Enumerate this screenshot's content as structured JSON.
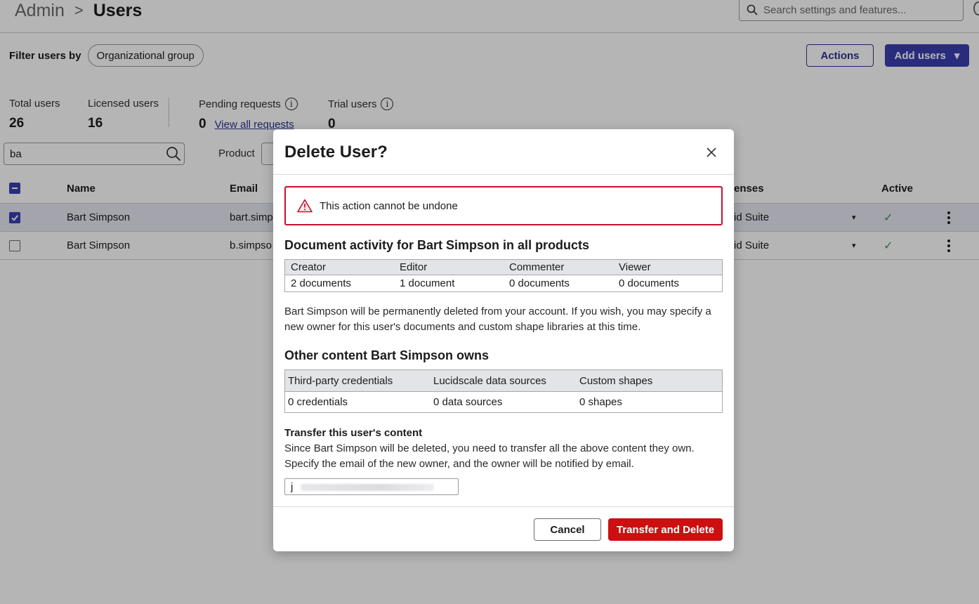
{
  "breadcrumb": {
    "parent": "Admin",
    "separator": ">",
    "current": "Users"
  },
  "search": {
    "placeholder": "Search settings and features...",
    "icon": "search-icon"
  },
  "filter": {
    "label": "Filter users by",
    "chip": "Organizational group"
  },
  "toolbar": {
    "actions_label": "Actions",
    "add_label": "Add users",
    "add_caret": "▾"
  },
  "stats": {
    "total_label": "Total users",
    "total_value": "26",
    "licensed_label": "Licensed users",
    "licensed_value": "16",
    "pending_label": "Pending requests",
    "pending_value": "0",
    "pending_link": "View all requests",
    "trial_label": "Trial users",
    "trial_value": "0",
    "info_glyph": "i"
  },
  "user_search": {
    "value": "ba"
  },
  "product_filter": {
    "label": "Product"
  },
  "table": {
    "headers": {
      "name": "Name",
      "email": "Email",
      "licenses": "enses",
      "active": "Active"
    },
    "rows": [
      {
        "selected": true,
        "name": "Bart Simpson",
        "email": "bart.simp",
        "license": "id Suite",
        "caret": "▾",
        "active": "✓"
      },
      {
        "selected": false,
        "name": "Bart Simpson",
        "email": "b.simpso",
        "license": "id Suite",
        "caret": "▾",
        "active": "✓"
      }
    ]
  },
  "modal": {
    "title": "Delete User?",
    "alert": "This action cannot be undone",
    "doc_heading": "Document activity for Bart Simpson in all products",
    "doc_table": {
      "headers": [
        "Creator",
        "Editor",
        "Commenter",
        "Viewer"
      ],
      "values": [
        "2 documents",
        "1 document",
        "0 documents",
        "0 documents"
      ]
    },
    "delete_note": "Bart Simpson will be permanently deleted from your account. If you wish, you may specify a new owner for this user's documents and custom shape libraries at this time.",
    "other_heading": "Other content Bart Simpson owns",
    "other_table": {
      "headers": [
        "Third-party credentials",
        "Lucidscale data sources",
        "Custom shapes"
      ],
      "values": [
        "0 credentials",
        "0 data sources",
        "0 shapes"
      ]
    },
    "transfer_heading": "Transfer this user's content",
    "transfer_note": "Since Bart Simpson will be deleted, you need to transfer all the above content they own. Specify the email of the new owner, and the owner will be notified by email.",
    "email_value": "j",
    "cancel_label": "Cancel",
    "confirm_label": "Transfer and Delete"
  },
  "colors": {
    "accent": "#3a3fb0",
    "danger": "#cc0f10",
    "success": "#2e9e45",
    "overlay": "rgba(0,0,0,0.29)"
  }
}
